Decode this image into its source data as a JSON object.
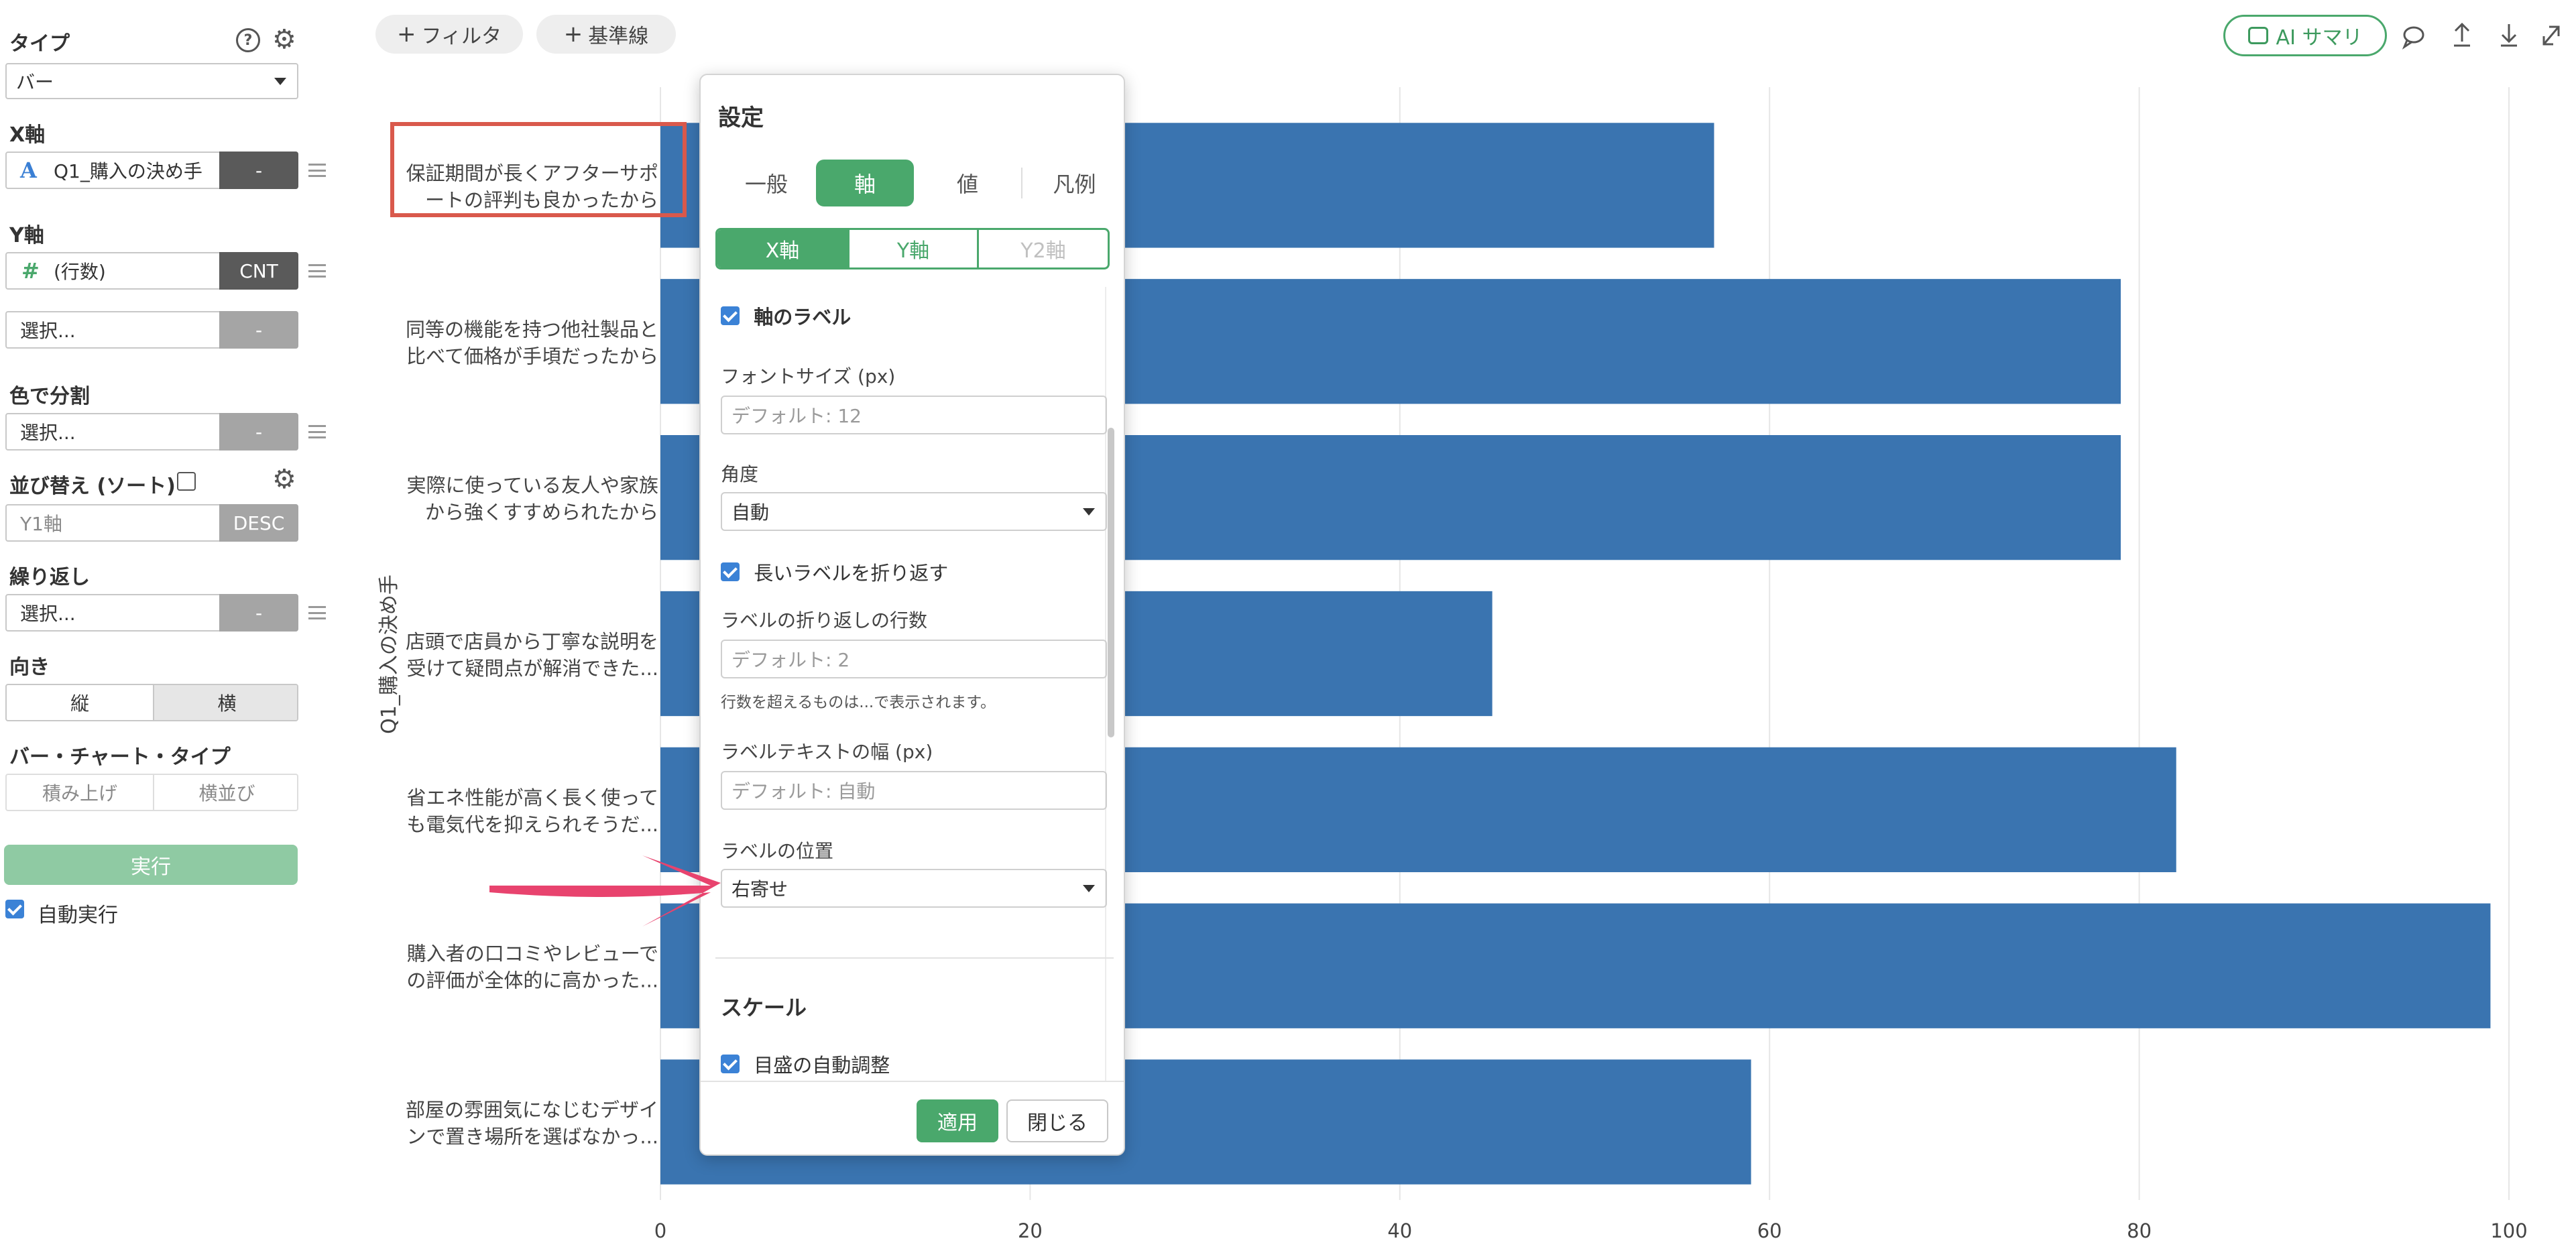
{
  "left_panel": {
    "type_label": "タイプ",
    "type_value": "バー",
    "x_axis_label": "X軸",
    "x_axis_field": "Q1_購入の決め手",
    "x_axis_pill": "-",
    "y_axis_label": "Y軸",
    "y_axis_field": "(行数)",
    "y_axis_pill": "CNT",
    "y_axis_extra_placeholder": "選択...",
    "y_axis_extra_pill": "-",
    "color_label": "色で分割",
    "color_placeholder": "選択...",
    "color_pill": "-",
    "sort_label": "並び替え (ソート)",
    "sort_field": "Y1軸",
    "sort_pill": "DESC",
    "repeat_label": "繰り返し",
    "repeat_placeholder": "選択...",
    "repeat_pill": "-",
    "direction_label": "向き",
    "direction_vertical": "縦",
    "direction_horizontal": "横",
    "bar_type_label": "バー・チャート・タイプ",
    "bar_type_stacked": "積み上げ",
    "bar_type_side": "横並び",
    "run_button": "実行",
    "auto_run_label": "自動実行"
  },
  "toolbar": {
    "filter_button": "フィルタ",
    "reference_button": "基準線",
    "ai_summary_button": "AI サマリ"
  },
  "chart_data": {
    "type": "bar",
    "orientation": "horizontal",
    "ylabel": "Q1_購入の決め手",
    "categories": [
      [
        "保証期間が長くアフターサポ",
        "ートの評判も良かったから"
      ],
      [
        "同等の機能を持つ他社製品と",
        "比べて価格が手頃だったから"
      ],
      [
        "実際に使っている友人や家族",
        "から強くすすめられたから"
      ],
      [
        "店頭で店員から丁寧な説明を",
        "受けて疑問点が解消できた..."
      ],
      [
        "省エネ性能が高く長く使って",
        "も電気代を抑えられそうだ..."
      ],
      [
        "購入者の口コミやレビューで",
        "の評価が全体的に高かった..."
      ],
      [
        "部屋の雰囲気になじむデザイ",
        "ンで置き場所を選ばなかっ..."
      ]
    ],
    "values": [
      57,
      79,
      79,
      45,
      82,
      99,
      59
    ],
    "xlim": [
      0,
      100
    ],
    "xticks": [
      0,
      20,
      40,
      60,
      80,
      100
    ],
    "bar_color": "#3a74b0",
    "grid": true
  },
  "dialog": {
    "title": "設定",
    "tabs": [
      "一般",
      "軸",
      "値",
      "凡例"
    ],
    "active_tab": "軸",
    "axis_tabs": [
      "X軸",
      "Y軸",
      "Y2軸"
    ],
    "axis_label_checkbox": "軸のラベル",
    "font_size_label": "フォントサイズ (px)",
    "font_size_placeholder": "デフォルト: 12",
    "angle_label": "角度",
    "angle_value": "自動",
    "wrap_checkbox": "長いラベルを折り返す",
    "wrap_lines_label": "ラベルの折り返しの行数",
    "wrap_lines_placeholder": "デフォルト: 2",
    "wrap_note": "行数を超えるものは...で表示されます。",
    "label_width_label": "ラベルテキストの幅 (px)",
    "label_width_placeholder": "デフォルト: 自動",
    "label_position_label": "ラベルの位置",
    "label_position_value": "右寄せ",
    "scale_heading": "スケール",
    "auto_scale_checkbox": "目盛の自動調整",
    "apply_button": "適用",
    "close_button": "閉じる"
  },
  "colors": {
    "accent": "#4aa86c",
    "bar": "#3a74b0",
    "highlight": "#d9594c",
    "arrow": "#e8436e"
  }
}
